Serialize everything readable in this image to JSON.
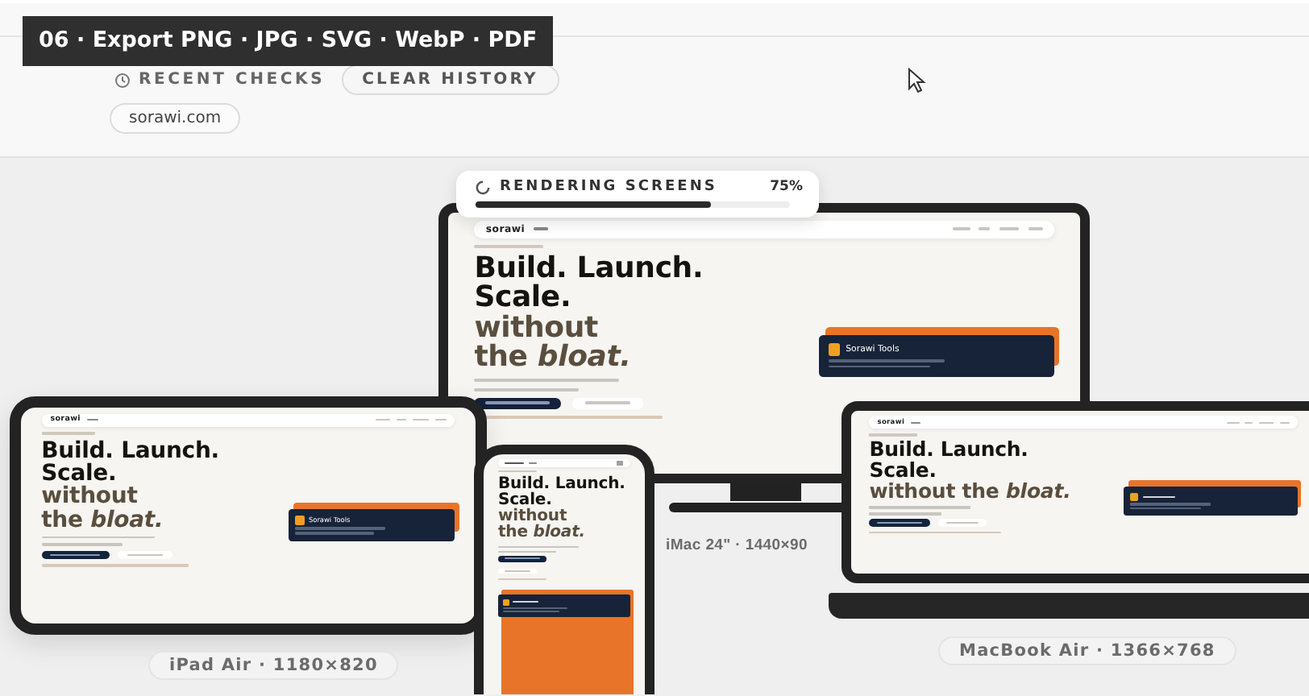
{
  "caption": "06 · Export PNG · JPG · SVG · WebP · PDF",
  "recent": {
    "label": "RECENT CHECKS",
    "clear_button": "CLEAR HISTORY",
    "chips": [
      "sorawi.com"
    ]
  },
  "progress": {
    "label": "RENDERING SCREENS",
    "reading": "75%",
    "level": 0.75
  },
  "devices": [
    {
      "kind": "imac",
      "label": "iMac 24\" · 1440×90",
      "site": {
        "logo": "sorawi",
        "headline": [
          {
            "text": "Build. Launch.",
            "muted": false
          },
          {
            "text": "Scale.",
            "muted": false
          },
          {
            "text": "without",
            "muted": true
          },
          {
            "text": "the *bloat.*",
            "muted": true
          }
        ],
        "card_title": "Sorawi Tools"
      }
    },
    {
      "kind": "ipad",
      "label": "iPad Air · 1180×820",
      "site": {
        "logo": "sorawi",
        "headline": [
          {
            "text": "Build. Launch.",
            "muted": false
          },
          {
            "text": "Scale.",
            "muted": false
          },
          {
            "text": "without",
            "muted": true
          },
          {
            "text": "the *bloat.*",
            "muted": true
          }
        ],
        "card_title": "Sorawi Tools"
      }
    },
    {
      "kind": "phone",
      "site": {
        "headline": [
          {
            "text": "Build. Launch.",
            "muted": false
          },
          {
            "text": "Scale.",
            "muted": false
          },
          {
            "text": "without",
            "muted": true
          },
          {
            "text": "the *bloat.*",
            "muted": true
          }
        ]
      }
    },
    {
      "kind": "macbook",
      "label": "MacBook Air · 1366×768",
      "site": {
        "logo": "sorawi",
        "headline": [
          {
            "text": "Build. Launch.",
            "muted": false
          },
          {
            "text": "Scale.",
            "muted": false
          },
          {
            "text": "without the *bloat.*",
            "muted": true
          }
        ]
      }
    }
  ]
}
